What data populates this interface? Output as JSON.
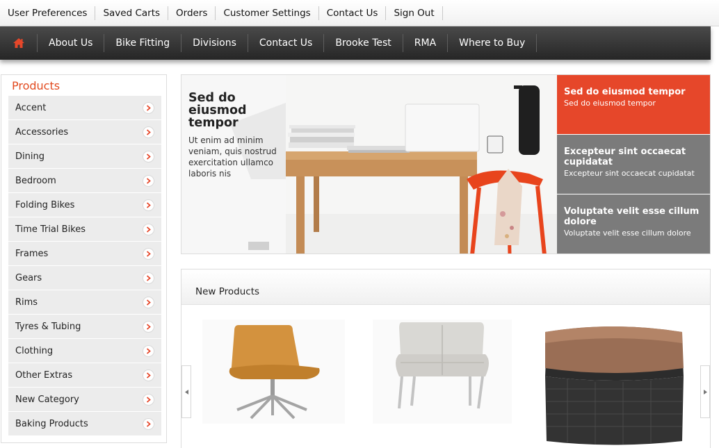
{
  "topbar": {
    "items": [
      "User Preferences",
      "Saved Carts",
      "Orders",
      "Customer Settings",
      "Contact Us",
      "Sign Out"
    ]
  },
  "mainnav": {
    "home_icon": "home-icon",
    "items": [
      "About Us",
      "Bike Fitting",
      "Divisions",
      "Contact Us",
      "Brooke Test",
      "RMA",
      "Where to Buy"
    ]
  },
  "sidebar": {
    "title": "Products",
    "items": [
      "Accent",
      "Accessories",
      "Dining",
      "Bedroom",
      "Folding Bikes",
      "Time Trial Bikes",
      "Frames",
      "Gears",
      "Rims",
      "Tyres & Tubing",
      "Clothing",
      "Other Extras",
      "New Category",
      "Baking Products"
    ]
  },
  "hero": {
    "title": "Sed do eiusmod tempor",
    "description": "Ut enim ad minim veniam, quis nostrud exercitation ullamco laboris nis",
    "tabs": [
      {
        "title": "Sed do eiusmod tempor",
        "subtitle": "Sed do eiusmod tempor"
      },
      {
        "title": "Excepteur sint occaecat cupidatat",
        "subtitle": "Excepteur sint occaecat cupidatat"
      },
      {
        "title": "Voluptate velit esse cillum dolore",
        "subtitle": "Voluptate velit esse cillum dolore"
      }
    ]
  },
  "new_products": {
    "heading": "New Products"
  },
  "colors": {
    "accent": "#e6472a",
    "nav_dark": "#2e2e2e",
    "tab_gray": "#7b7b7b"
  }
}
